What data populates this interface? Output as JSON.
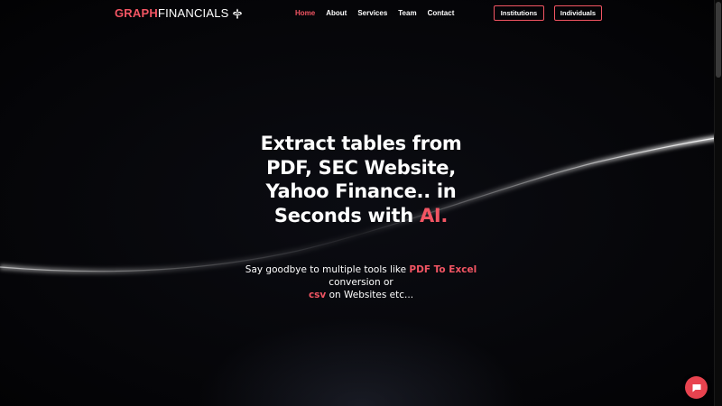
{
  "brand": {
    "part1": "GRAPH",
    "part2": "FINANCIALS",
    "icon": "fleur-de-lis-icon"
  },
  "nav": {
    "links": [
      {
        "label": "Home",
        "active": true
      },
      {
        "label": "About",
        "active": false
      },
      {
        "label": "Services",
        "active": false
      },
      {
        "label": "Team",
        "active": false
      },
      {
        "label": "Contact",
        "active": false
      }
    ],
    "buttons": {
      "institutions": "Institutions",
      "individuals": "Individuals"
    }
  },
  "hero": {
    "title_line1": "Extract tables from",
    "title_line2": "PDF, SEC Website,",
    "title_line3": "Yahoo Finance.. in",
    "title_line4_prefix": "Seconds with ",
    "title_line4_accent": "AI.",
    "sub_prefix": "Say goodbye to multiple tools like ",
    "sub_highlight1": "PDF To Excel",
    "sub_middle": "conversion or",
    "sub_highlight2": "csv",
    "sub_suffix": " on Websites etc..."
  },
  "chat": {
    "icon": "chat-bubble-icon"
  },
  "colors": {
    "accent": "#f25563",
    "background": "#000000",
    "text": "#ffffff",
    "chat_button": "#e8434f"
  }
}
